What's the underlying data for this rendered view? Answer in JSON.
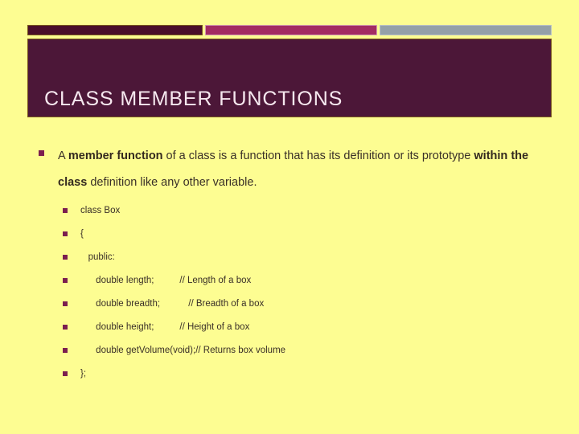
{
  "slide": {
    "background_color": "#fdfd92",
    "title": "CLASS MEMBER FUNCTIONS",
    "title_color": "#f6e8ef",
    "title_block_color": "#4c1738",
    "accent_bars": [
      {
        "name": "accent-bar-dark",
        "color": "#4a0f2b"
      },
      {
        "name": "accent-bar-magenta",
        "color": "#a32c62"
      },
      {
        "name": "accent-bar-grey",
        "color": "#94a0a8"
      }
    ],
    "bullet_color": "#7b1f4f",
    "body_text_color": "#3a3028"
  },
  "body": {
    "paragraph": {
      "part1": "A ",
      "bold1": "member function",
      "part2": " of a class is a function that has its definition or its prototype ",
      "bold2": "within the class",
      "part3": " definition like any other variable."
    },
    "code_lines": [
      "class Box",
      "{",
      "   public:",
      "      double length;          // Length of a box",
      "      double breadth;           // Breadth of a box",
      "      double height;          // Height of a box",
      "      double getVolume(void);// Returns box volume",
      "};"
    ]
  }
}
